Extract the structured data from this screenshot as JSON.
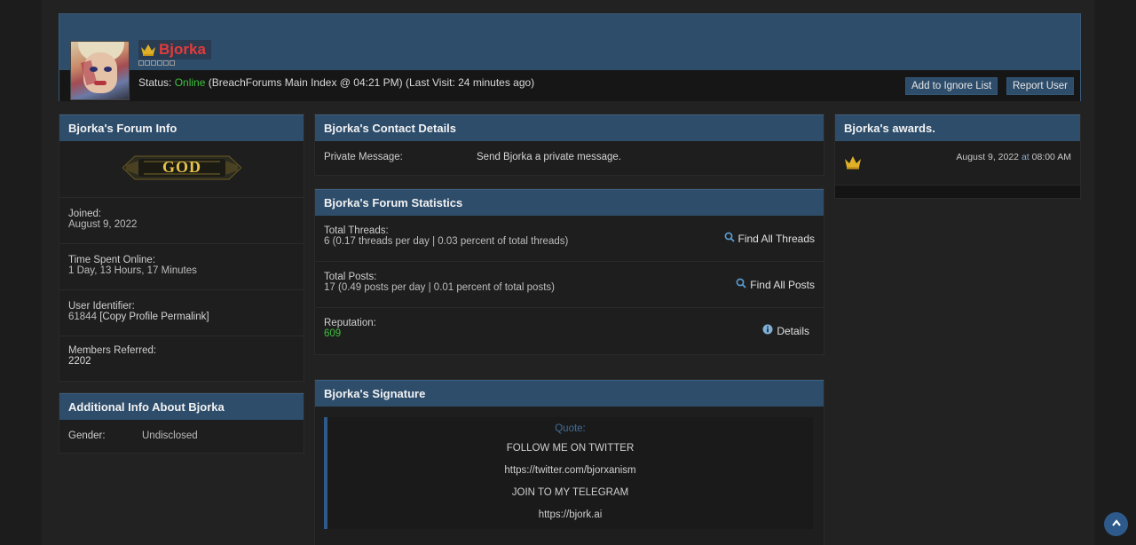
{
  "profile": {
    "username": "Bjorka",
    "status_label": "Status:",
    "status_value": "Online",
    "status_detail": "(BreachForums Main Index @ 04:21 PM) (Last Visit: 24 minutes ago)",
    "buttons": {
      "ignore": "Add to Ignore List",
      "report": "Report User"
    }
  },
  "forum_info": {
    "title": "Bjorka's Forum Info",
    "rank_badge": "GOD",
    "joined_label": "Joined:",
    "joined_value": "August 9, 2022",
    "time_label": "Time Spent Online:",
    "time_value": "1 Day, 13 Hours, 17 Minutes",
    "uid_label": "User Identifier:",
    "uid_value": "61844",
    "permalink": "[Copy Profile Permalink]",
    "referred_label": "Members Referred:",
    "referred_value": "2202"
  },
  "additional": {
    "title": "Additional Info About Bjorka",
    "gender_label": "Gender:",
    "gender_value": "Undisclosed"
  },
  "contact": {
    "title": "Bjorka's Contact Details",
    "pm_label": "Private Message:",
    "pm_link": "Send Bjorka a private message."
  },
  "stats": {
    "title": "Bjorka's Forum Statistics",
    "threads_label": "Total Threads:",
    "threads_value": "6 (0.17 threads per day | 0.03 percent of total threads)",
    "threads_action": "Find All Threads",
    "posts_label": "Total Posts:",
    "posts_value": "17 (0.49 posts per day | 0.01 percent of total posts)",
    "posts_action": "Find All Posts",
    "rep_label": "Reputation:",
    "rep_value": "609",
    "rep_action": "Details"
  },
  "signature": {
    "title": "Bjorka's Signature",
    "quote_title": "Quote:",
    "lines": [
      "FOLLOW ME ON TWITTER",
      "https://twitter.com/bjorxanism",
      "JOIN TO MY TELEGRAM",
      "https://bjork.ai"
    ]
  },
  "awards": {
    "title": "Bjorka's awards.",
    "date": "August 9, 2022",
    "at": "at",
    "time": "08:00 AM"
  },
  "colors": {
    "accent": "#2d4d6b",
    "username": "#e23b3b",
    "online": "#3fbf3f",
    "gold": "#e0b126"
  }
}
